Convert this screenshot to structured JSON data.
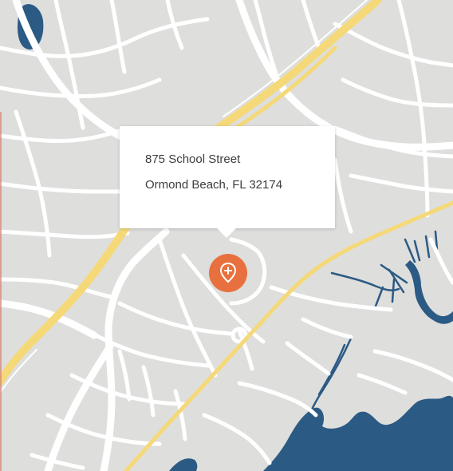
{
  "map": {
    "colors": {
      "land": "#dededc",
      "road": "#ffffff",
      "highway": "#f5d978",
      "water": "#2b5a84",
      "pin": "#e8703e"
    }
  },
  "info_card": {
    "street": "875 School Street",
    "city_line": "Ormond Beach, FL 32174"
  },
  "marker": {
    "icon": "location-pin-plus-icon"
  }
}
